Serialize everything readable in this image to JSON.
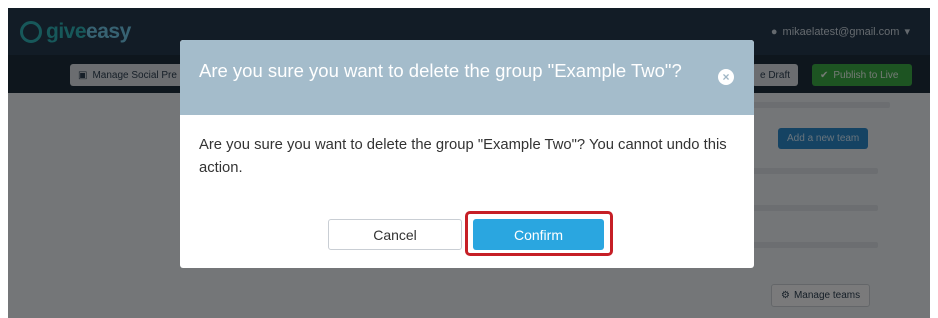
{
  "app": {
    "logo_text_a": "give",
    "logo_text_b": "easy",
    "user_email": "mikaelatest@gmail.com",
    "toolbar": {
      "social_label": "Manage Social Pre",
      "draft_label": "e Draft",
      "publish_label": "Publish to Live"
    },
    "side": {
      "add_team_label": "Add a new team",
      "manage_teams_label": "Manage teams"
    }
  },
  "modal": {
    "title": "Are you sure you want to delete the group \"Example Two\"?",
    "close_symbol": "×",
    "body": "Are you sure you want to delete the group \"Example Two\"? You cannot undo this action.",
    "cancel_label": "Cancel",
    "confirm_label": "Confirm"
  },
  "colors": {
    "header": "#a4bccb",
    "confirm": "#2aa6e0",
    "highlight": "#c61f26",
    "navbar": "#24394d"
  },
  "icons": {
    "logo": "giveeasy-swirl-icon",
    "user": "user-icon",
    "caret": "caret-down-icon",
    "social": "image-icon",
    "publish": "thumbs-up-icon",
    "manage": "gear-icon",
    "close": "close-icon"
  }
}
